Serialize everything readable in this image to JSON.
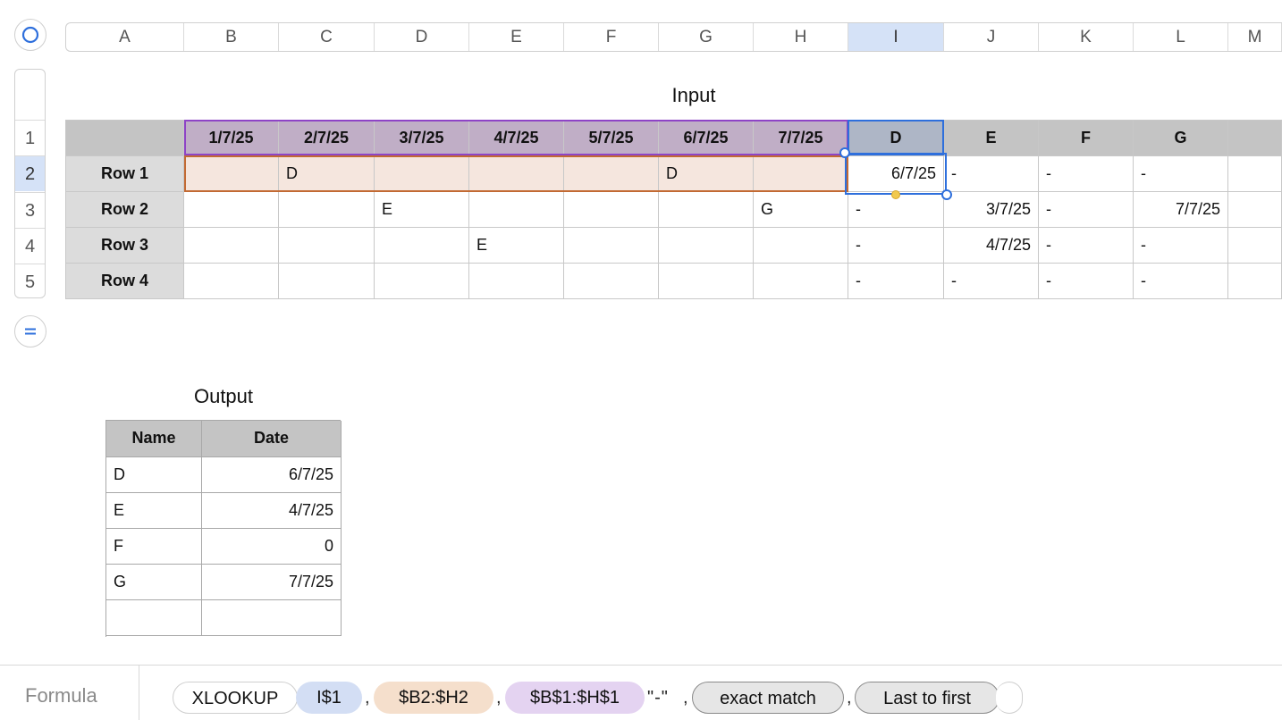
{
  "columns": [
    "A",
    "B",
    "C",
    "D",
    "E",
    "F",
    "G",
    "H",
    "I",
    "J",
    "K",
    "L",
    "M"
  ],
  "selected_column": "I",
  "rows": [
    "1",
    "2",
    "3",
    "4",
    "5"
  ],
  "selected_row": "2",
  "input_table": {
    "title": "Input",
    "header": [
      "",
      "1/7/25",
      "2/7/25",
      "3/7/25",
      "4/7/25",
      "5/7/25",
      "6/7/25",
      "7/7/25",
      "D",
      "E",
      "F",
      "G",
      ""
    ],
    "body": [
      [
        "Row 1",
        "",
        "D",
        "",
        "",
        "",
        "D",
        "",
        "6/7/25",
        "-",
        "-",
        "-",
        ""
      ],
      [
        "Row 2",
        "",
        "",
        "E",
        "",
        "",
        "",
        "G",
        "-",
        "3/7/25",
        "-",
        "7/7/25",
        ""
      ],
      [
        "Row 3",
        "",
        "",
        "",
        "E",
        "",
        "",
        "",
        "-",
        "4/7/25",
        "-",
        "-",
        ""
      ],
      [
        "Row 4",
        "",
        "",
        "",
        "",
        "",
        "",
        "",
        "-",
        "-",
        "-",
        "-",
        ""
      ]
    ]
  },
  "output_table": {
    "title": "Output",
    "headers": [
      "Name",
      "Date"
    ],
    "rows": [
      [
        "D",
        "6/7/25"
      ],
      [
        "E",
        "4/7/25"
      ],
      [
        "F",
        "0"
      ],
      [
        "G",
        "7/7/25"
      ],
      [
        "",
        ""
      ]
    ]
  },
  "formula": {
    "label": "Formula",
    "function": "XLOOKUP",
    "args": [
      "I$1",
      "$B2:$H2",
      "$B$1:$H$1",
      "\"-\"",
      "exact match",
      "Last to first"
    ],
    "separator": ",",
    "colors": {
      "arg1": "#d3def4",
      "arg2": "#f5dfcc",
      "arg3": "#e4d3f1",
      "pill": "#e6e6e6"
    }
  },
  "colors": {
    "selection_blue": "#2e6fdc",
    "highlight_purple": "#8e44c6",
    "highlight_orange": "#c26a33",
    "fill_handle": "#f1c94f"
  }
}
